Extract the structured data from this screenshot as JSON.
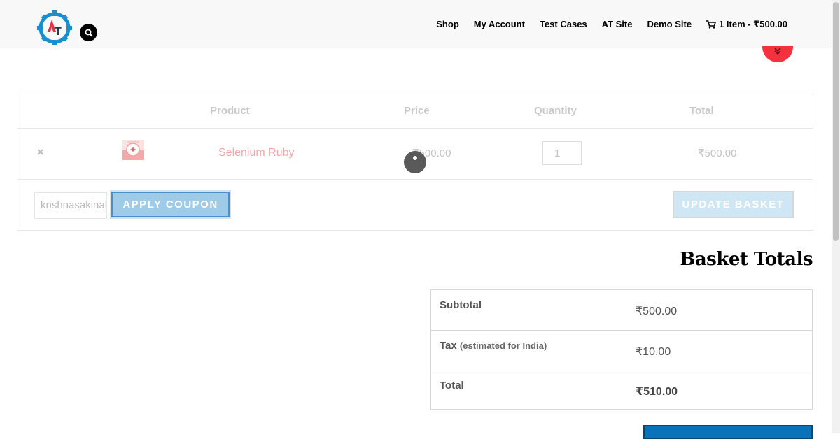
{
  "header": {
    "nav": [
      "Shop",
      "My Account",
      "Test Cases",
      "AT Site",
      "Demo Site"
    ],
    "cart_link": "1 Item - ₹500.00"
  },
  "cart": {
    "headers": {
      "product": "Product",
      "price": "Price",
      "quantity": "Quantity",
      "total": "Total"
    },
    "items": [
      {
        "remove": "×",
        "name": "Selenium Ruby",
        "price": "₹500.00",
        "quantity": "1",
        "total": "₹500.00"
      }
    ],
    "coupon_value": "krishnasakinala",
    "apply_coupon": "APPLY COUPON",
    "update_basket": "UPDATE BASKET"
  },
  "totals": {
    "title": "Basket Totals",
    "subtotal_label": "Subtotal",
    "subtotal_value": "₹500.00",
    "tax_label": "Tax",
    "tax_note": "(estimated for India)",
    "tax_value": "₹10.00",
    "total_label": "Total",
    "total_value": "₹510.00"
  },
  "colors": {
    "accent_red": "#f5303f",
    "button_blue": "#0a72b8",
    "link_pink": "#f3a8a8"
  }
}
